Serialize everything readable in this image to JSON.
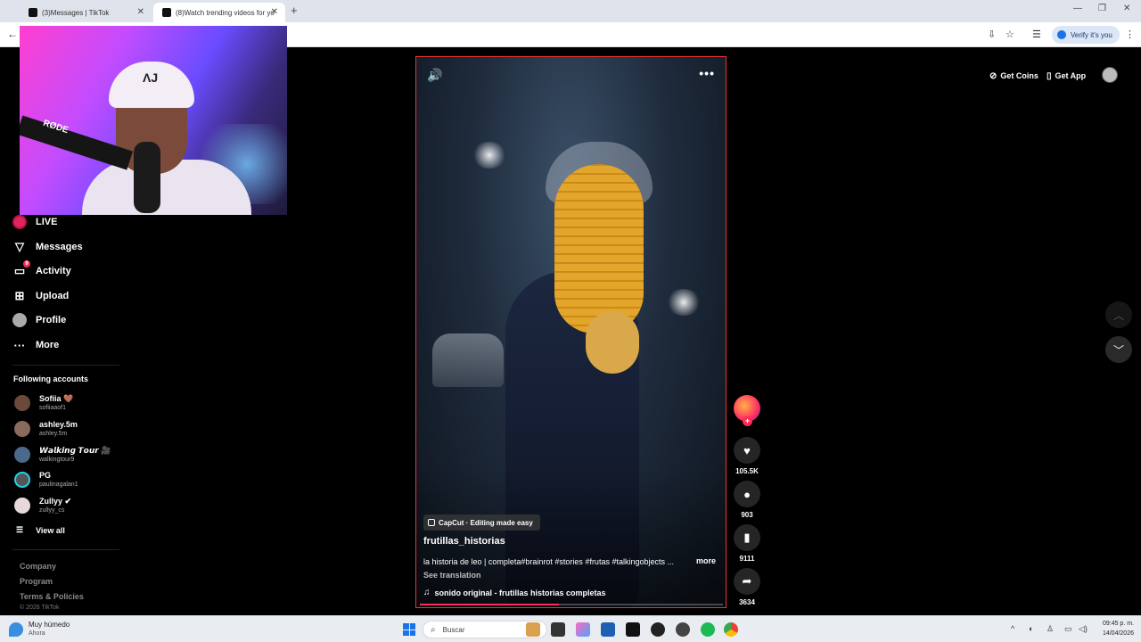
{
  "browser": {
    "tabs": [
      {
        "title": "(3)Messages | TikTok"
      },
      {
        "title": "(8)Watch trending videos for yo"
      }
    ],
    "new_tab": "+",
    "window_controls": {
      "minimize": "—",
      "maximize": "❐",
      "close": "✕"
    },
    "verify_label": "Verify it's you"
  },
  "sidebar": {
    "items": [
      {
        "label": "LIVE"
      },
      {
        "label": "Messages"
      },
      {
        "label": "Activity",
        "badge": "9"
      },
      {
        "label": "Upload"
      },
      {
        "label": "Profile"
      },
      {
        "label": "More"
      }
    ],
    "following_title": "Following accounts",
    "following": [
      {
        "name": "Sofiia 🤎",
        "handle": "sofiiaaof1"
      },
      {
        "name": "ashley.5m",
        "handle": "ashley.5m"
      },
      {
        "name": "𝙒𝙖𝙡𝙠𝙞𝙣𝙜 𝙏𝙤𝙪𝙧 🎥",
        "handle": "walkingtour9"
      },
      {
        "name": "PG",
        "handle": "paulinagalan1"
      },
      {
        "name": "Zullyy ✔",
        "handle": "zullyy_cs"
      }
    ],
    "view_all": "View all",
    "footer": [
      "Company",
      "Program",
      "Terms & Policies"
    ],
    "copyright": "© 2026 TikTok"
  },
  "header": {
    "get_coins": "Get Coins",
    "get_app": "Get App"
  },
  "video": {
    "capcut_label": "CapCut · Editing made easy",
    "author": "frutillas_historias",
    "description": "la historia de leo | completa#brainrot #stories #frutas #talkingobjects ...",
    "more": "more",
    "see_translation": "See translation",
    "sound": "sonido original - frutillas historias completas",
    "progress": 0.46
  },
  "actions": {
    "likes": "105.5K",
    "comments": "903",
    "saves": "9111",
    "shares": "3634"
  },
  "taskbar": {
    "weather_title": "Muy húmedo",
    "weather_sub": "Ahora",
    "search_placeholder": "Buscar",
    "time": "09:45 p. m.",
    "date": "14/04/2026"
  }
}
